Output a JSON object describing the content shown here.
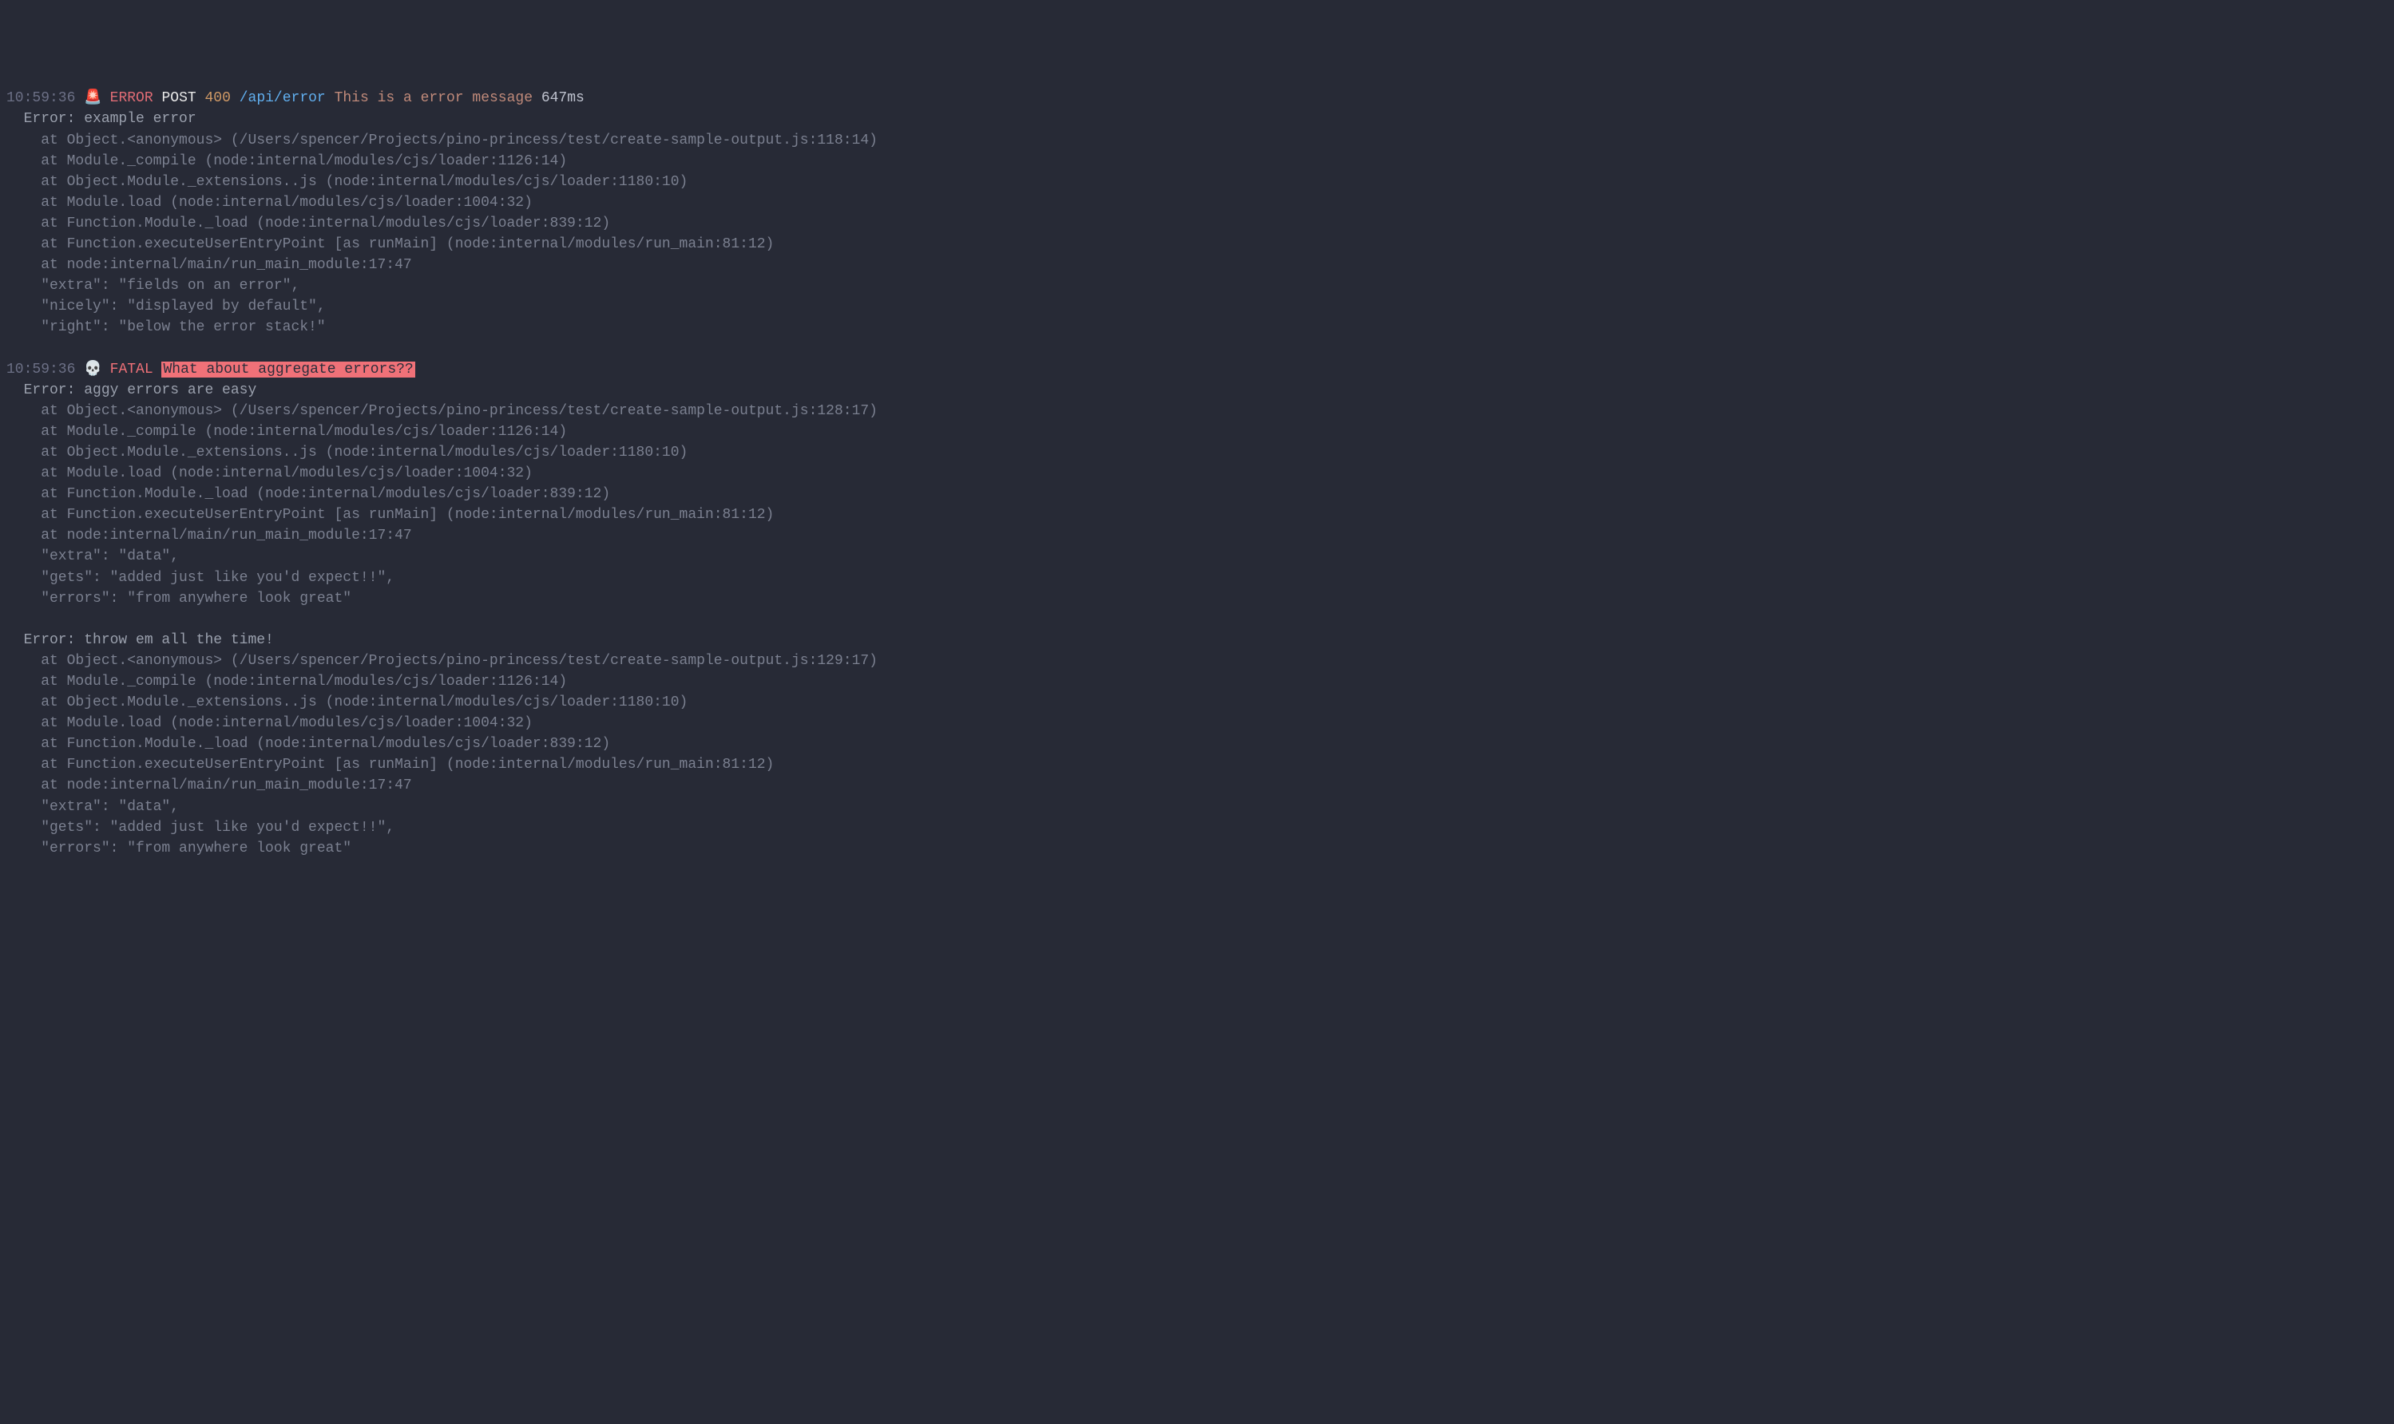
{
  "entries": [
    {
      "timestamp": "10:59:36",
      "icon": "🚨",
      "level": "ERROR",
      "level_class": "level-error",
      "method": "POST",
      "status": "400",
      "path": "/api/error",
      "message": "This is a error message",
      "message_class": "msg-error",
      "duration": "647ms",
      "errors": [
        {
          "title": "Error: example error",
          "stack": [
            "at Object.<anonymous> (/Users/spencer/Projects/pino-princess/test/create-sample-output.js:118:14)",
            "at Module._compile (node:internal/modules/cjs/loader:1126:14)",
            "at Object.Module._extensions..js (node:internal/modules/cjs/loader:1180:10)",
            "at Module.load (node:internal/modules/cjs/loader:1004:32)",
            "at Function.Module._load (node:internal/modules/cjs/loader:839:12)",
            "at Function.executeUserEntryPoint [as runMain] (node:internal/modules/run_main:81:12)",
            "at node:internal/main/run_main_module:17:47"
          ],
          "extras": [
            "\"extra\": \"fields on an error\",",
            "\"nicely\": \"displayed by default\",",
            "\"right\": \"below the error stack!\""
          ]
        }
      ]
    },
    {
      "timestamp": "10:59:36",
      "icon": "💀",
      "level": "FATAL",
      "level_class": "level-fatal",
      "message": "What about aggregate errors??",
      "message_class": "msg-fatal-hl",
      "errors": [
        {
          "title": "Error: aggy errors are easy",
          "stack": [
            "at Object.<anonymous> (/Users/spencer/Projects/pino-princess/test/create-sample-output.js:128:17)",
            "at Module._compile (node:internal/modules/cjs/loader:1126:14)",
            "at Object.Module._extensions..js (node:internal/modules/cjs/loader:1180:10)",
            "at Module.load (node:internal/modules/cjs/loader:1004:32)",
            "at Function.Module._load (node:internal/modules/cjs/loader:839:12)",
            "at Function.executeUserEntryPoint [as runMain] (node:internal/modules/run_main:81:12)",
            "at node:internal/main/run_main_module:17:47"
          ],
          "extras": [
            "\"extra\": \"data\",",
            "\"gets\": \"added just like you'd expect!!\",",
            "\"errors\": \"from anywhere look great\""
          ]
        },
        {
          "title": "Error: throw em all the time!",
          "stack": [
            "at Object.<anonymous> (/Users/spencer/Projects/pino-princess/test/create-sample-output.js:129:17)",
            "at Module._compile (node:internal/modules/cjs/loader:1126:14)",
            "at Object.Module._extensions..js (node:internal/modules/cjs/loader:1180:10)",
            "at Module.load (node:internal/modules/cjs/loader:1004:32)",
            "at Function.Module._load (node:internal/modules/cjs/loader:839:12)",
            "at Function.executeUserEntryPoint [as runMain] (node:internal/modules/run_main:81:12)",
            "at node:internal/main/run_main_module:17:47"
          ],
          "extras": [
            "\"extra\": \"data\",",
            "\"gets\": \"added just like you'd expect!!\",",
            "\"errors\": \"from anywhere look great\""
          ]
        }
      ]
    }
  ]
}
